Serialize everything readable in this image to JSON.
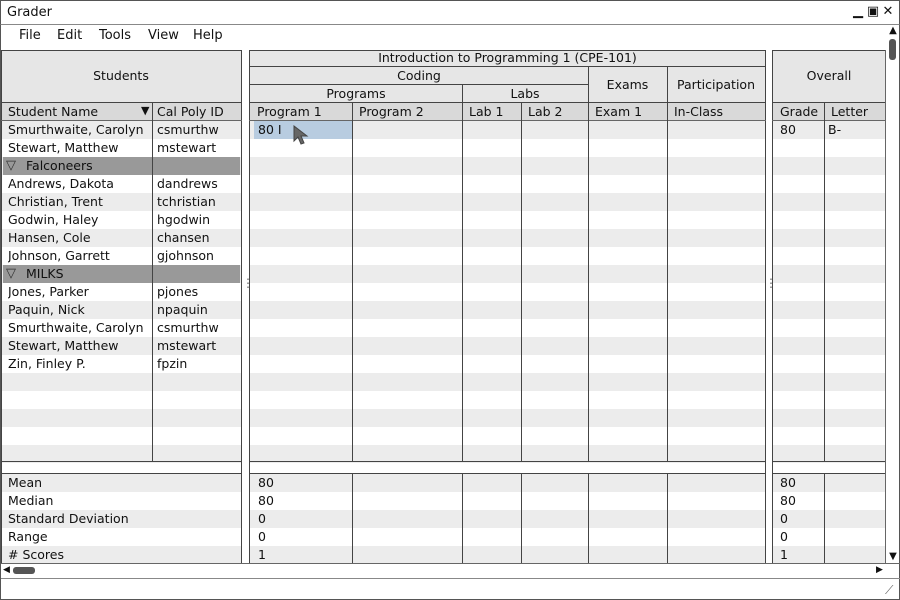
{
  "window": {
    "title": "Grader"
  },
  "menu": [
    "File",
    "Edit",
    "Tools",
    "View",
    "Help"
  ],
  "left": {
    "header": "Students",
    "col_name": "Student Name",
    "col_id": "Cal Poly ID",
    "rows": [
      {
        "type": "s",
        "name": "Smurthwaite, Carolyn",
        "id": "csmurthw"
      },
      {
        "type": "s",
        "name": "Stewart, Matthew",
        "id": "mstewart"
      },
      {
        "type": "g",
        "name": "Falconeers"
      },
      {
        "type": "s",
        "name": "Andrews, Dakota",
        "id": "dandrews"
      },
      {
        "type": "s",
        "name": "Christian, Trent",
        "id": "tchristian"
      },
      {
        "type": "s",
        "name": "Godwin, Haley",
        "id": "hgodwin"
      },
      {
        "type": "s",
        "name": "Hansen, Cole",
        "id": "chansen"
      },
      {
        "type": "s",
        "name": "Johnson, Garrett",
        "id": "gjohnson"
      },
      {
        "type": "g",
        "name": "MILKS"
      },
      {
        "type": "s",
        "name": "Jones, Parker",
        "id": "pjones"
      },
      {
        "type": "s",
        "name": "Paquin, Nick",
        "id": "npaquin"
      },
      {
        "type": "s",
        "name": "Smurthwaite, Carolyn",
        "id": "csmurthw"
      },
      {
        "type": "s",
        "name": "Stewart, Matthew",
        "id": "mstewart"
      },
      {
        "type": "s",
        "name": "Zin, Finley P.",
        "id": "fpzin"
      }
    ],
    "stats": [
      "Mean",
      "Median",
      "Standard Deviation",
      "Range",
      "# Scores"
    ]
  },
  "middle": {
    "course": "Introduction to Programming 1 (CPE-101)",
    "coding": "Coding",
    "programs": "Programs",
    "labs": "Labs",
    "exams": "Exams",
    "participation": "Participation",
    "cols": [
      "Program 1",
      "Program 2",
      "Lab 1",
      "Lab 2",
      "Exam 1",
      "In-Class"
    ],
    "edit_value": "80 I",
    "stats": [
      "80",
      "80",
      "0",
      "0",
      "1"
    ]
  },
  "right": {
    "header": "Overall",
    "cols": [
      "Grade",
      "Letter"
    ],
    "row": [
      "80",
      "B-"
    ],
    "stats": [
      "80",
      "80",
      "0",
      "0",
      "1"
    ]
  }
}
